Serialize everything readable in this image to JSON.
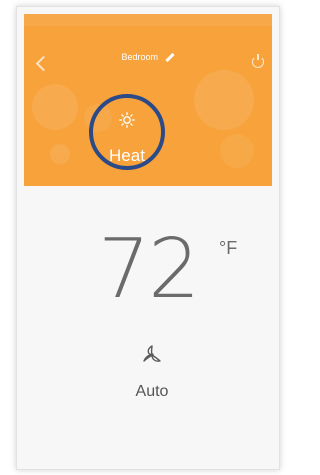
{
  "header": {
    "title": "Bedroom",
    "back_icon": "chevron-left-icon",
    "edit_icon": "pencil-icon",
    "power_icon": "power-icon",
    "background_color": "#f7a23a"
  },
  "mode": {
    "icon": "sun-icon",
    "label": "Heat",
    "ring_color": "#2c4a88"
  },
  "temperature": {
    "value": "72",
    "unit": "°F"
  },
  "fan": {
    "icon": "fan-icon",
    "label": "Auto"
  }
}
